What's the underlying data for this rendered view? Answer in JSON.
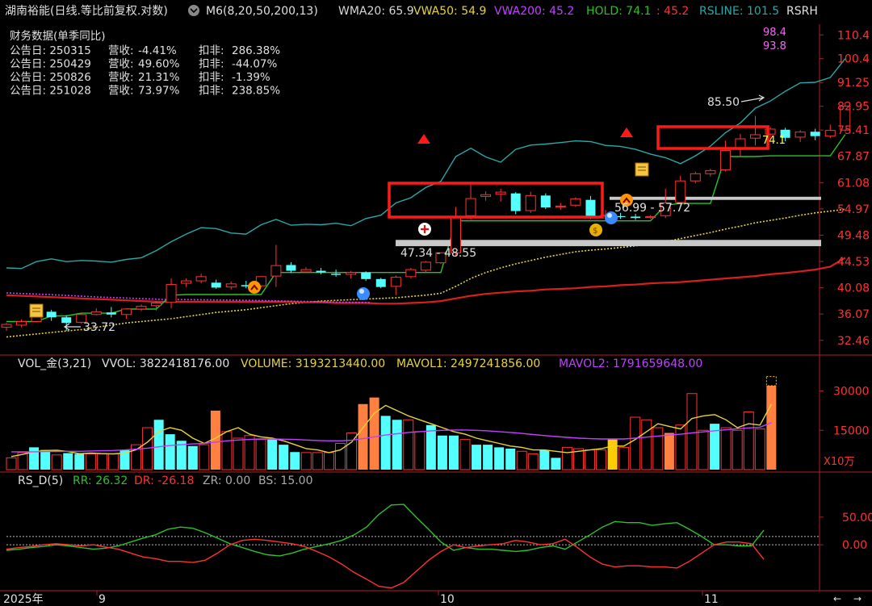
{
  "header": {
    "title": "湖南裕能(日线.等比前复权.对数)",
    "indicator": "M6(8,20,50,200,13)",
    "wma20": "WMA20: 65.9",
    "vwa50": "VWA50: 54.9",
    "vwa200": "VWA200: 45.2",
    "hold": "HOLD: 74.1",
    "hold_val2": ": 45.2",
    "rsline": "RSLINE: 101.5",
    "rsrh": "RSRH"
  },
  "financials": {
    "title": "财务数据(单季同比)",
    "rows": [
      {
        "date": "公告日: 250315",
        "rev_label": "营收:",
        "rev": "-4.41%",
        "np_label": "扣非:",
        "np": "286.38%"
      },
      {
        "date": "公告日: 250429",
        "rev_label": "营收:",
        "rev": "49.60%",
        "np_label": "扣非:",
        "np": "-44.07%"
      },
      {
        "date": "公告日: 250826",
        "rev_label": "营收:",
        "rev": "21.31%",
        "np_label": "扣非:",
        "np": "-1.39%"
      },
      {
        "date": "公告日: 251028",
        "rev_label": "营收:",
        "rev": "73.97%",
        "np_label": "扣非:",
        "np": "238.85%"
      }
    ]
  },
  "annotations": {
    "high": "85.50",
    "low": "33.72",
    "zone1": "47.34 - 48.55",
    "zone2": "56.99 - 57.72",
    "hold_label": "74.1",
    "rs_a": "98.4",
    "rs_b": "93.8"
  },
  "price_axis": [
    "110.4",
    "100.4",
    "91.25",
    "82.95",
    "75.41",
    "67.87",
    "61.08",
    "54.97",
    "49.48",
    "44.53",
    "40.08",
    "36.07",
    "32.46"
  ],
  "volume_panel": {
    "header": "VOL_金(3,21)",
    "vvol": "VVOL: 3822418176.00",
    "volume": "VOLUME: 3193213440.00",
    "mavol1": "MAVOL1: 2497241856.00",
    "mavol2": "MAVOL2: 1791659648.00",
    "axis": [
      "30000",
      "15000"
    ],
    "unit": "X10万"
  },
  "rs_panel": {
    "header": "RS_D(5)",
    "rr": "RR: 26.32",
    "dr": "DR: -26.18",
    "zr": "ZR: 0.00",
    "bs": "BS: 15.00",
    "axis": [
      "50.00",
      "0.00"
    ]
  },
  "time_axis": {
    "labels": [
      "2025年",
      "9",
      "10",
      "11"
    ]
  },
  "colors": {
    "up": "#ff3232",
    "down": "#54ffff",
    "wma20": "#2aa7a7",
    "vwa50": "#e8d33a",
    "vwa200": "#d62020",
    "hold": "#2bc22b",
    "purple": "#c040ff",
    "yellow": "#ffcc00",
    "orange": "#ff8040"
  },
  "chart_data": [
    {
      "type": "candlestick",
      "title": "湖南裕能(日线.等比前复权.对数)",
      "scale": "log",
      "ylim": [
        31,
        116
      ],
      "ohlc": [
        [
          34.2,
          34.8,
          33.7,
          34.6
        ],
        [
          34.5,
          35.3,
          34.2,
          35.0
        ],
        [
          35.0,
          36.8,
          34.9,
          36.5
        ],
        [
          36.4,
          36.7,
          35.1,
          35.6
        ],
        [
          35.6,
          35.9,
          33.72,
          34.8
        ],
        [
          34.9,
          36.2,
          34.7,
          36.0
        ],
        [
          36.0,
          36.9,
          35.9,
          36.4
        ],
        [
          36.3,
          37.1,
          35.6,
          36.0
        ],
        [
          36.0,
          36.9,
          35.4,
          36.8
        ],
        [
          36.8,
          37.5,
          36.5,
          37.2
        ],
        [
          37.3,
          38.0,
          36.6,
          37.7
        ],
        [
          37.8,
          41.6,
          36.9,
          40.6
        ],
        [
          40.8,
          41.6,
          40.2,
          41.2
        ],
        [
          41.2,
          42.4,
          40.8,
          41.9
        ],
        [
          40.9,
          41.4,
          39.9,
          40.1
        ],
        [
          40.2,
          41.1,
          39.8,
          40.7
        ],
        [
          40.5,
          41.2,
          40.0,
          40.3
        ],
        [
          40.4,
          42.0,
          40.1,
          41.9
        ],
        [
          42.0,
          47.6,
          40.2,
          43.8
        ],
        [
          43.9,
          44.4,
          42.5,
          42.9
        ],
        [
          42.7,
          43.5,
          42.6,
          43.1
        ],
        [
          42.9,
          43.4,
          42.3,
          42.6
        ],
        [
          42.4,
          43.1,
          41.9,
          42.2
        ],
        [
          42.3,
          42.9,
          41.6,
          42.6
        ],
        [
          42.6,
          42.8,
          41.2,
          41.5
        ],
        [
          41.5,
          41.7,
          40.0,
          40.2
        ],
        [
          40.3,
          42.1,
          38.9,
          41.8
        ],
        [
          41.9,
          43.4,
          41.6,
          43.1
        ],
        [
          43.0,
          44.6,
          42.6,
          44.4
        ],
        [
          44.3,
          46.2,
          44.1,
          46.1
        ],
        [
          46.1,
          55.4,
          45.5,
          53.1
        ],
        [
          53.5,
          61.3,
          52.6,
          57.3
        ],
        [
          57.8,
          59.0,
          56.8,
          58.2
        ],
        [
          58.3,
          59.6,
          56.6,
          58.8
        ],
        [
          58.5,
          58.8,
          53.8,
          54.5
        ],
        [
          54.6,
          58.9,
          54.1,
          58.0
        ],
        [
          58.0,
          58.5,
          54.9,
          55.3
        ],
        [
          55.4,
          56.3,
          54.8,
          55.6
        ],
        [
          55.8,
          57.6,
          55.4,
          57.2
        ],
        [
          57.0,
          57.9,
          52.8,
          53.4
        ],
        [
          53.5,
          54.7,
          52.9,
          53.6
        ],
        [
          53.4,
          54.1,
          52.8,
          53.3
        ],
        [
          53.3,
          53.9,
          52.6,
          53.0
        ],
        [
          53.1,
          53.6,
          52.8,
          53.3
        ],
        [
          53.5,
          59.6,
          53.0,
          56.3
        ],
        [
          56.4,
          62.8,
          55.9,
          61.5
        ],
        [
          61.5,
          63.8,
          60.9,
          63.3
        ],
        [
          63.3,
          64.6,
          62.6,
          64.1
        ],
        [
          64.3,
          72.3,
          63.9,
          69.5
        ],
        [
          69.8,
          74.3,
          67.8,
          72.8
        ],
        [
          73.0,
          79.8,
          70.9,
          74.0
        ],
        [
          74.2,
          76.3,
          72.7,
          75.7
        ],
        [
          75.5,
          76.1,
          72.1,
          73.1
        ],
        [
          73.3,
          75.4,
          71.9,
          74.8
        ],
        [
          74.9,
          75.8,
          72.4,
          73.6
        ],
        [
          73.6,
          77.1,
          73.0,
          75.3
        ],
        [
          75.4,
          84.2,
          74.9,
          83.0
        ]
      ],
      "series": [
        {
          "name": "WMA20",
          "values": [
            43.4,
            43.3,
            44.5,
            45.0,
            44.5,
            44.7,
            44.6,
            44.4,
            44.9,
            45.2,
            46.5,
            48.2,
            49.7,
            51.0,
            50.8,
            49.9,
            49.7,
            51.6,
            52.7,
            51.5,
            51.7,
            51.6,
            51.9,
            51.4,
            52.9,
            53.6,
            56.3,
            57.5,
            59.9,
            61.4,
            67.8,
            70.1,
            67.7,
            66.3,
            69.8,
            71.0,
            71.3,
            71.7,
            72.2,
            72.0,
            70.9,
            70.6,
            69.8,
            68.5,
            67.5,
            65.9,
            68.0,
            70.7,
            74.6,
            77.6,
            82.3,
            84.7,
            88.1,
            91.1,
            91.3,
            93.1,
            100.4
          ]
        },
        {
          "name": "VWA50",
          "values": [
            32.9,
            33.1,
            33.3,
            33.5,
            33.7,
            33.9,
            34.2,
            34.5,
            34.8,
            35.0,
            35.2,
            35.4,
            35.7,
            36.0,
            36.3,
            36.5,
            36.7,
            37.0,
            37.3,
            37.6,
            37.8,
            38.0,
            38.1,
            38.2,
            38.3,
            38.4,
            38.5,
            38.7,
            38.9,
            39.2,
            40.3,
            41.6,
            42.6,
            43.4,
            44.1,
            44.7,
            45.3,
            45.8,
            46.3,
            46.6,
            46.8,
            47.1,
            47.4,
            47.8,
            48.2,
            48.8,
            49.4,
            50.0,
            50.7,
            51.3,
            52.0,
            52.5,
            53.0,
            53.6,
            54.1,
            54.5,
            54.9
          ]
        },
        {
          "name": "VWA200",
          "values": [
            38.9,
            38.8,
            38.7,
            38.6,
            38.5,
            38.4,
            38.3,
            38.2,
            38.1,
            38.0,
            37.9,
            37.9,
            37.9,
            37.9,
            37.9,
            37.9,
            37.9,
            37.9,
            37.9,
            37.9,
            37.8,
            37.8,
            37.7,
            37.7,
            37.7,
            37.6,
            37.6,
            37.7,
            37.8,
            38.0,
            38.4,
            38.8,
            39.1,
            39.3,
            39.5,
            39.6,
            39.8,
            39.9,
            40.0,
            40.2,
            40.3,
            40.5,
            40.6,
            40.8,
            40.9,
            41.0,
            41.2,
            41.4,
            41.6,
            41.8,
            42.0,
            42.3,
            42.5,
            42.8,
            43.1,
            43.6,
            45.2
          ]
        },
        {
          "name": "HOLD",
          "values": [
            35.0,
            35.0,
            35.0,
            35.8,
            35.8,
            36.2,
            36.2,
            36.2,
            36.8,
            36.8,
            36.8,
            38.9,
            39.0,
            39.0,
            39.0,
            39.0,
            39.0,
            39.0,
            42.6,
            42.6,
            42.6,
            42.6,
            42.6,
            42.6,
            42.6,
            42.6,
            42.6,
            42.6,
            42.6,
            42.6,
            52.4,
            52.4,
            52.4,
            52.4,
            52.4,
            52.4,
            52.4,
            52.4,
            52.4,
            52.4,
            52.4,
            52.4,
            52.4,
            52.4,
            55.8,
            56.2,
            56.2,
            56.2,
            67.8,
            67.8,
            67.8,
            68.0,
            68.0,
            68.0,
            68.0,
            68.0,
            74.1
          ]
        }
      ],
      "levels": [
        {
          "label": "47.34 - 48.55",
          "low": 47.34,
          "high": 48.55
        },
        {
          "label": "56.99 - 57.72",
          "low": 56.99,
          "high": 57.72
        }
      ]
    },
    {
      "type": "bar",
      "title": "VOL_金(3,21)",
      "ylabel": "X10万",
      "ylim": [
        0,
        36000
      ],
      "values": [
        4500,
        6500,
        8500,
        7500,
        5600,
        6300,
        6000,
        6000,
        6000,
        6000,
        7500,
        9500,
        16000,
        19000,
        13500,
        11000,
        9000,
        9500,
        22500,
        14500,
        12000,
        13000,
        11500,
        11500,
        9500,
        6700,
        6500,
        6500,
        6500,
        10000,
        14000,
        25000,
        27500,
        20500,
        19000,
        19000,
        14500,
        17000,
        13000,
        13000,
        11500,
        9500,
        9500,
        8500,
        8000,
        7000,
        6000,
        7500,
        4500,
        8500,
        8000,
        7500,
        7500,
        11500,
        8500,
        20000,
        19000,
        16000,
        14000,
        17000,
        29000,
        15000,
        17500,
        16000,
        15000,
        22000,
        15500,
        32000
      ],
      "styles": [
        "u",
        "u",
        "d",
        "d",
        "u",
        "d",
        "d",
        "u",
        "u",
        "u",
        "d",
        "u",
        "u",
        "d",
        "d",
        "d",
        "d",
        "u",
        "h",
        "u",
        "u",
        "u",
        "u",
        "d",
        "d",
        "d",
        "u",
        "u",
        "u",
        "u",
        "u",
        "h",
        "h",
        "d",
        "d",
        "u",
        "u",
        "d",
        "d",
        "d",
        "u",
        "d",
        "d",
        "d",
        "d",
        "u",
        "u",
        "d",
        "d",
        "u",
        "u",
        "u",
        "u",
        "y",
        "u",
        "u",
        "u",
        "u",
        "h",
        "u",
        "u",
        "u",
        "d",
        "u",
        "u",
        "u",
        "u",
        "h"
      ],
      "series": [
        {
          "name": "MAVOL1",
          "values": [
            5000,
            5800,
            6800,
            7300,
            7400,
            6900,
            6100,
            6300,
            6100,
            6000,
            6300,
            7600,
            10500,
            14500,
            16000,
            15000,
            12000,
            10000,
            12000,
            14500,
            16000,
            13500,
            12500,
            12000,
            11000,
            9500,
            8000,
            7500,
            6500,
            7500,
            10500,
            16000,
            21500,
            24500,
            22500,
            20500,
            19000,
            17500,
            16000,
            14500,
            13500,
            12000,
            11000,
            10000,
            9000,
            8500,
            7500,
            7500,
            7000,
            6500,
            7000,
            7500,
            8000,
            9000,
            9000,
            11500,
            14500,
            17500,
            16500,
            15500,
            19500,
            20500,
            21000,
            19000,
            16000,
            17500,
            17000,
            24970
          ]
        },
        {
          "name": "MAVOL2",
          "values": [
            6800,
            6800,
            6800,
            6900,
            6900,
            7000,
            7000,
            7100,
            7200,
            7300,
            7500,
            7800,
            8200,
            8700,
            9200,
            9500,
            9800,
            10000,
            10500,
            11000,
            11300,
            11500,
            11700,
            11700,
            11600,
            11500,
            11300,
            11100,
            11000,
            11000,
            11200,
            11800,
            12500,
            13200,
            13700,
            14200,
            14500,
            14800,
            15000,
            15100,
            15100,
            15000,
            14800,
            14500,
            14200,
            13800,
            13400,
            13000,
            12600,
            12300,
            12000,
            11800,
            11700,
            11700,
            11700,
            12000,
            12400,
            12800,
            13200,
            13500,
            14000,
            14400,
            14800,
            15200,
            15600,
            15900,
            16200,
            17916
          ]
        }
      ]
    },
    {
      "type": "line",
      "title": "RS_D(5)",
      "ylim": [
        -80,
        95
      ],
      "series": [
        {
          "name": "RR",
          "values": [
            -10,
            -8,
            -5,
            -3,
            0,
            -2,
            -5,
            -8,
            -6,
            -2,
            5,
            12,
            18,
            28,
            32,
            30,
            22,
            12,
            2,
            -5,
            -12,
            -18,
            -20,
            -15,
            -8,
            -3,
            2,
            8,
            18,
            32,
            55,
            72,
            73,
            50,
            28,
            5,
            -10,
            -5,
            -8,
            -8,
            -10,
            -12,
            -10,
            -5,
            -2,
            -8,
            5,
            18,
            32,
            42,
            40,
            40,
            35,
            38,
            40,
            28,
            15,
            0,
            0,
            -2,
            -2,
            26.32
          ]
        },
        {
          "name": "DR",
          "values": [
            -8,
            -5,
            -3,
            0,
            2,
            0,
            -2,
            0,
            -4,
            -8,
            -15,
            -22,
            -25,
            -30,
            -30,
            -32,
            -28,
            -15,
            0,
            8,
            10,
            8,
            5,
            2,
            -3,
            -12,
            -22,
            -35,
            -50,
            -62,
            -75,
            -78,
            -68,
            -48,
            -28,
            -12,
            0,
            -5,
            -2,
            0,
            2,
            8,
            5,
            0,
            2,
            10,
            -5,
            -22,
            -35,
            -40,
            -38,
            -38,
            -40,
            -40,
            -42,
            -30,
            -15,
            0,
            5,
            5,
            2,
            -26.18
          ]
        }
      ],
      "reference_lines": [
        0,
        15
      ]
    }
  ]
}
